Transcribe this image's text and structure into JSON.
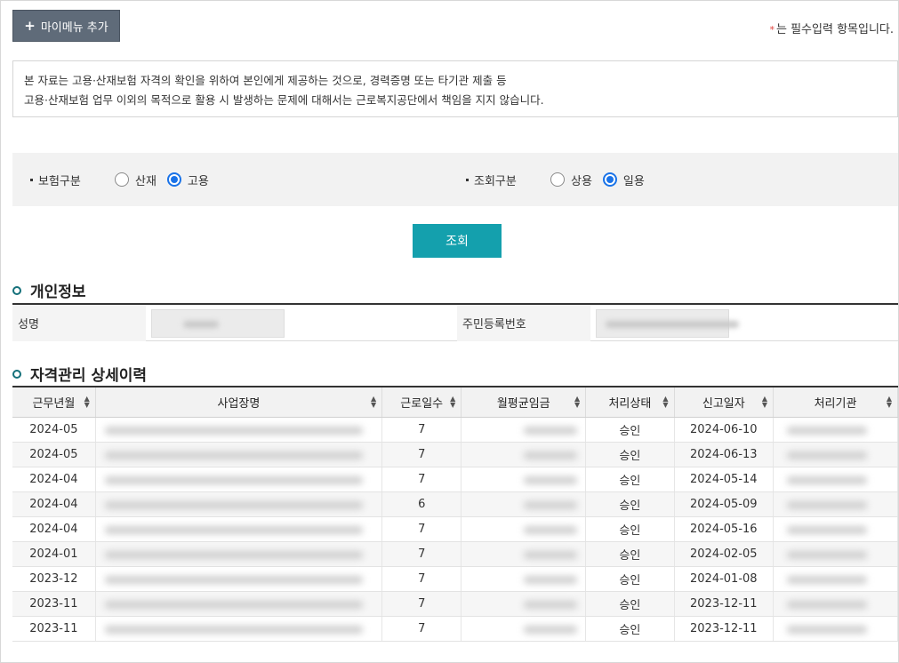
{
  "toolbar": {
    "add_menu_label": "마이메뉴 추가",
    "plus": "+"
  },
  "required_note": {
    "star": "*",
    "text": "는 필수입력 항목입니다."
  },
  "notice": {
    "line1": "본 자료는 고용·산재보험 자격의 확인을 위하여 본인에게 제공하는 것으로, 경력증명 또는 타기관 제출 등",
    "line2": "고용·산재보험 업무 이외의 목적으로 활용 시 발생하는 문제에 대해서는 근로복지공단에서 책임을 지지 않습니다."
  },
  "search": {
    "insurance_type": {
      "label": "보험구분",
      "options": [
        "산재",
        "고용"
      ],
      "selected": "고용"
    },
    "query_type": {
      "label": "조회구분",
      "options": [
        "상용",
        "일용"
      ],
      "selected": "일용"
    },
    "submit_label": "조회"
  },
  "personal_info": {
    "title": "개인정보",
    "name_label": "성명",
    "rrn_label": "주민등록번호"
  },
  "history": {
    "title": "자격관리 상세이력",
    "columns": [
      "근무년월",
      "사업장명",
      "근로일수",
      "월평균임금",
      "처리상태",
      "신고일자",
      "처리기관"
    ],
    "rows": [
      {
        "month": "2024-05",
        "days": "7",
        "status": "승인",
        "report_date": "2024-06-10"
      },
      {
        "month": "2024-05",
        "days": "7",
        "status": "승인",
        "report_date": "2024-06-13"
      },
      {
        "month": "2024-04",
        "days": "7",
        "status": "승인",
        "report_date": "2024-05-14"
      },
      {
        "month": "2024-04",
        "days": "6",
        "status": "승인",
        "report_date": "2024-05-09"
      },
      {
        "month": "2024-04",
        "days": "7",
        "status": "승인",
        "report_date": "2024-05-16"
      },
      {
        "month": "2024-01",
        "days": "7",
        "status": "승인",
        "report_date": "2024-02-05"
      },
      {
        "month": "2023-12",
        "days": "7",
        "status": "승인",
        "report_date": "2024-01-08"
      },
      {
        "month": "2023-11",
        "days": "7",
        "status": "승인",
        "report_date": "2023-12-11"
      },
      {
        "month": "2023-11",
        "days": "7",
        "status": "승인",
        "report_date": "2023-12-11"
      }
    ]
  },
  "colors": {
    "button_gray": "#5f6b79",
    "button_teal": "#14a0ad",
    "radio_blue": "#1a73e8",
    "section_dot": "#14707a",
    "required_star": "#e0403a"
  }
}
